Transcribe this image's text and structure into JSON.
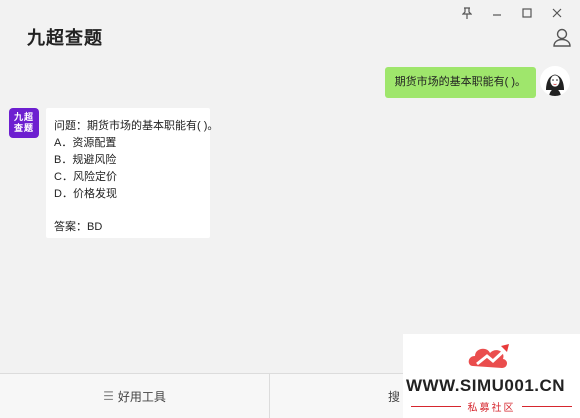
{
  "app": {
    "title": "九超查题"
  },
  "window_controls": [
    "pin",
    "minimize",
    "maximize",
    "close"
  ],
  "question_bubble": {
    "text": "期货市场的基本职能有( )。"
  },
  "bot": {
    "avatar_text_line1": "九超",
    "avatar_text_line2": "查题",
    "avatar_color": "#6d1fd0"
  },
  "answer": {
    "question": "问题：期货市场的基本职能有( )。",
    "options": [
      "A．资源配置",
      "B．规避风险",
      "C．风险定价",
      "D．价格发现"
    ],
    "result": "答案：BD"
  },
  "bottom_bar": {
    "tab1_label": "好用工具",
    "tab2_label": "搜"
  },
  "watermark": {
    "url": "WWW.SIMU001.CN",
    "sub": "私募社区"
  },
  "colors": {
    "bubble_green": "#9fe66c",
    "bot_purple": "#6d1fd0",
    "watermark_red": "#d6262e"
  }
}
